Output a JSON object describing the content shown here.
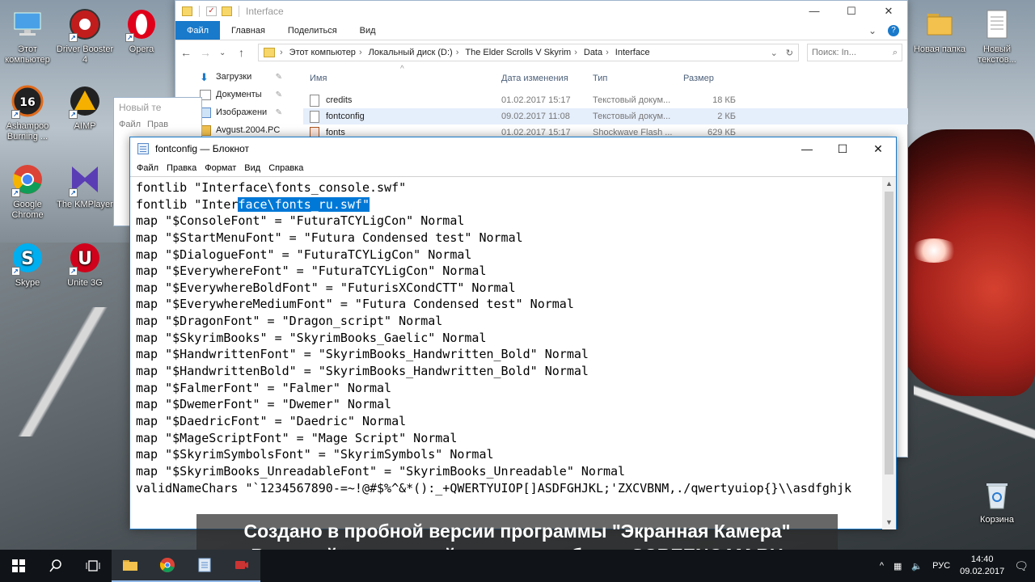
{
  "desktop": {
    "left_icons": [
      {
        "label": "Этот компьютер",
        "icon": "computer-icon",
        "color": "#4aa0e6"
      },
      {
        "label": "Driver Booster 4",
        "icon": "driver-booster-icon",
        "color": "#c21d1d"
      },
      {
        "label": "Opera",
        "icon": "opera-icon",
        "color": "#e0001a"
      },
      {
        "label": "Ashampoo Burning ...",
        "icon": "ashampoo-icon",
        "color": "#222222"
      },
      {
        "label": "AIMP",
        "icon": "aimp-icon",
        "color": "#f5b000"
      },
      {
        "label": "Google Chrome",
        "icon": "chrome-icon",
        "color": "#db4437"
      },
      {
        "label": "The KMPlayer",
        "icon": "kmplayer-icon",
        "color": "#5a3db5"
      },
      {
        "label": "Skype",
        "icon": "skype-icon",
        "color": "#00aff0"
      },
      {
        "label": "Unite 3G",
        "icon": "unite-icon",
        "color": "#d0021b"
      }
    ],
    "right_icons": [
      {
        "label": "Новая папка",
        "icon": "folder-icon"
      },
      {
        "label": "Новый текстов...",
        "icon": "text-document-icon"
      },
      {
        "label": "Корзина",
        "icon": "recycle-bin-icon"
      }
    ]
  },
  "explorer": {
    "title": "Interface",
    "ribbon_tabs": [
      "Файл",
      "Главная",
      "Поделиться",
      "Вид"
    ],
    "address": [
      "Этот компьютер",
      "Локальный диск (D:)",
      "The Elder Scrolls V Skyrim",
      "Data",
      "Interface"
    ],
    "search_placeholder": "Поиск: In...",
    "nav_items": [
      "Загрузки",
      "Документы",
      "Изображени",
      "Avgust.2004.PC"
    ],
    "columns": [
      "Имя",
      "Дата изменения",
      "Тип",
      "Размер"
    ],
    "files": [
      {
        "name": "credits",
        "date": "01.02.2017 15:17",
        "type": "Текстовый докум...",
        "size": "18 КБ"
      },
      {
        "name": "fontconfig",
        "date": "09.02.2017 11:08",
        "type": "Текстовый докум...",
        "size": "2 КБ"
      },
      {
        "name": "fonts",
        "date": "01.02.2017 15:17",
        "type": "Shockwave Flash ...",
        "size": "629 КБ"
      }
    ]
  },
  "back_notepad": {
    "title": "Новый те",
    "menu": [
      "Файл",
      "Прав"
    ]
  },
  "notepad": {
    "title": "fontconfig — Блокнот",
    "menu": [
      "Файл",
      "Правка",
      "Формат",
      "Вид",
      "Справка"
    ],
    "lines": [
      "fontlib \"Interface\\fonts_console.swf\"",
      "fontlib \"Interface\\fonts_ru.swf\"",
      "map \"$ConsoleFont\" = \"FuturaTCYLigCon\" Normal",
      "map \"$StartMenuFont\" = \"Futura Condensed test\" Normal",
      "map \"$DialogueFont\" = \"FuturaTCYLigCon\" Normal",
      "map \"$EverywhereFont\" = \"FuturaTCYLigCon\" Normal",
      "map \"$EverywhereBoldFont\" = \"FuturisXCondCTT\" Normal",
      "map \"$EverywhereMediumFont\" = \"Futura Condensed test\" Normal",
      "map \"$DragonFont\" = \"Dragon_script\" Normal",
      "map \"$SkyrimBooks\" = \"SkyrimBooks_Gaelic\" Normal",
      "map \"$HandwrittenFont\" = \"SkyrimBooks_Handwritten_Bold\" Normal",
      "map \"$HandwrittenBold\" = \"SkyrimBooks_Handwritten_Bold\" Normal",
      "map \"$FalmerFont\" = \"Falmer\" Normal",
      "map \"$DwemerFont\" = \"Dwemer\" Normal",
      "map \"$DaedricFont\" = \"Daedric\" Normal",
      "map \"$MageScriptFont\" = \"Mage Script\" Normal",
      "map \"$SkyrimSymbolsFont\" = \"SkyrimSymbols\" Normal",
      "map \"$SkyrimBooks_UnreadableFont\" = \"SkyrimBooks_Unreadable\" Normal",
      "validNameChars \"`1234567890-=~!@#$%^&*():_+QWERTYUIOP[]ASDFGHJKL;'ZXCVBNM,./qwertyuiop{}\\\\asdfghjk"
    ],
    "selection": {
      "line": 1,
      "before": "fontlib \"Inter",
      "selected": "face\\fonts_ru.swf\""
    }
  },
  "watermark": {
    "line1": "Создано в пробной версии программы \"Экранная Камера\"",
    "line2": "В полной версии этой надписи не будет. SCREENCAM.RU"
  },
  "taskbar": {
    "lang": "РУС",
    "time": "14:40",
    "date": "09.02.2017",
    "accent": "#8fb7e6"
  }
}
